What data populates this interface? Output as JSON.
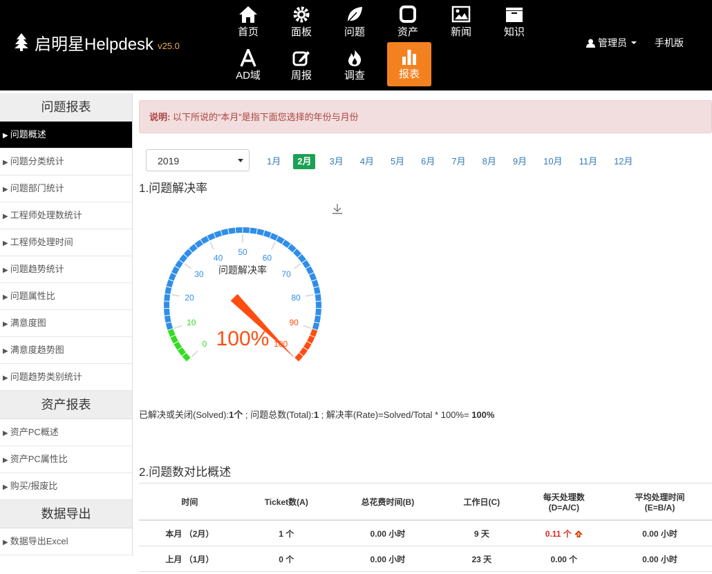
{
  "brand": {
    "name": "启明星Helpdesk",
    "version": "v25.0"
  },
  "nav": {
    "items": [
      {
        "label": "首页",
        "icon": "home-icon"
      },
      {
        "label": "面板",
        "icon": "gear-icon"
      },
      {
        "label": "问题",
        "icon": "leaf-icon"
      },
      {
        "label": "资产",
        "icon": "square-icon"
      },
      {
        "label": "新闻",
        "icon": "image-icon"
      },
      {
        "label": "知识",
        "icon": "folder-icon"
      },
      {
        "label": "AD域",
        "icon": "letter-a-icon"
      },
      {
        "label": "周报",
        "icon": "edit-icon"
      },
      {
        "label": "调查",
        "icon": "fire-icon"
      },
      {
        "label": "报表",
        "icon": "bar-chart-icon"
      }
    ],
    "active_color": "#f48120"
  },
  "user": {
    "label": "管理员",
    "icon": "user-icon"
  },
  "mobile": "手机版",
  "sidebar": {
    "sections": [
      {
        "title": "问题报表",
        "items": [
          "问题概述",
          "问题分类统计",
          "问题部门统计",
          "工程师处理数统计",
          "工程师处理时间",
          "问题趋势统计",
          "问题属性比",
          "满意度图",
          "满意度趋势图",
          "问题趋势类别统计"
        ]
      },
      {
        "title": "资产报表",
        "items": [
          "资产PC概述",
          "资产PC属性比",
          "购买/报废比"
        ]
      },
      {
        "title": "数据导出",
        "items": [
          "数据导出Excel"
        ]
      }
    ],
    "active_item": "问题概述"
  },
  "notice": {
    "label": "说明:",
    "text": "以下所说的“本月”是指下面您选择的年份与月份"
  },
  "year": "2019",
  "months": [
    "1月",
    "2月",
    "3月",
    "4月",
    "5月",
    "6月",
    "7月",
    "8月",
    "9月",
    "10月",
    "11月",
    "12月"
  ],
  "selected_month": "2月",
  "section1_title": "1.问题解决率",
  "gauge": {
    "title": "问题解决率",
    "value": 100,
    "value_label": "100%",
    "ticks": [
      "0",
      "10",
      "20",
      "30",
      "40",
      "50",
      "60",
      "70",
      "80",
      "90",
      "100"
    ],
    "colors": {
      "low": "#33dd22",
      "mid": "#2f8ee8",
      "high": "#ff4d12"
    }
  },
  "summary": {
    "solved_label": "已解决或关闭(Solved):",
    "solved_value": "1个",
    "total_label": " ; 问题总数(Total):",
    "total_value": "1",
    "rate_label": " ; 解决率(Rate)=Solved/Total * 100%= ",
    "rate_value": "100%"
  },
  "section2_title": "2.问题数对比概述",
  "table": {
    "headers": [
      [
        "时间"
      ],
      [
        "Ticket数(A)"
      ],
      [
        "总花费时间(B)"
      ],
      [
        "工作日(C)"
      ],
      [
        "每天处理数",
        "(D=A/C)"
      ],
      [
        "平均处理时间",
        "(E=B/A)"
      ]
    ],
    "rows": [
      [
        "本月 （2月）",
        "1 个",
        "0.00 小时",
        "9 天",
        "0.11 个",
        "0.00 小时"
      ],
      [
        "上月 （1月）",
        "0 个",
        "0.00 小时",
        "23 天",
        "0.00 个",
        "0.00 小时"
      ]
    ],
    "highlight_color": "#d9261c"
  }
}
